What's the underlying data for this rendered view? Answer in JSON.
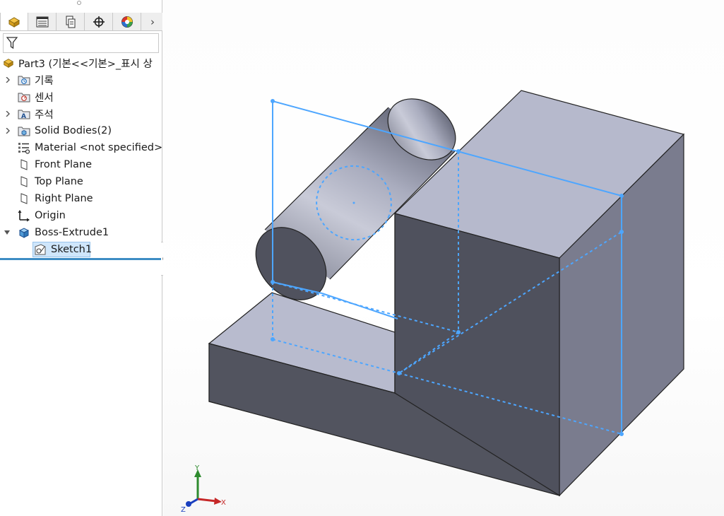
{
  "tabs": [
    {
      "name": "feature-manager-tab",
      "icon": "part-icon",
      "active": true
    },
    {
      "name": "property-manager-tab",
      "icon": "property-manager-icon",
      "active": false
    },
    {
      "name": "configuration-manager-tab",
      "icon": "configuration-manager-icon",
      "active": false
    },
    {
      "name": "dimxpert-manager-tab",
      "icon": "crosshair-icon",
      "active": false
    },
    {
      "name": "display-manager-tab",
      "icon": "appearance-icon",
      "active": false
    }
  ],
  "tab_more_glyph": "›",
  "tree": {
    "root_label": "Part3  (기본<<기본>_표시 상",
    "items": [
      {
        "label": "기록",
        "icon": "history-folder-icon",
        "expandable": true
      },
      {
        "label": "센서",
        "icon": "sensor-icon",
        "expandable": false
      },
      {
        "label": "주석",
        "icon": "annotations-icon",
        "expandable": true
      },
      {
        "label": "Solid Bodies(2)",
        "icon": "solid-bodies-icon",
        "expandable": true
      },
      {
        "label": "Material <not specified>",
        "icon": "material-icon",
        "expandable": false
      },
      {
        "label": "Front Plane",
        "icon": "plane-icon",
        "expandable": false
      },
      {
        "label": "Top Plane",
        "icon": "plane-icon",
        "expandable": false
      },
      {
        "label": "Right Plane",
        "icon": "plane-icon",
        "expandable": false
      },
      {
        "label": "Origin",
        "icon": "origin-icon",
        "expandable": false
      },
      {
        "label": "Boss-Extrude1",
        "icon": "extrude-icon",
        "expandable": true,
        "expanded": true
      },
      {
        "label": "Sketch1",
        "icon": "sketch-icon",
        "selected": true,
        "child": true
      }
    ]
  },
  "triad": {
    "x_label": "X",
    "y_label": "Y",
    "z_label": "Z"
  },
  "colors": {
    "accent": "#3d8cc4",
    "selection": "#cfe6fb",
    "sketch_plane": "#4da6ff",
    "model_light": "#b9bccf",
    "model_dark": "#4e505c",
    "model_mid": "#7a7c8e"
  }
}
